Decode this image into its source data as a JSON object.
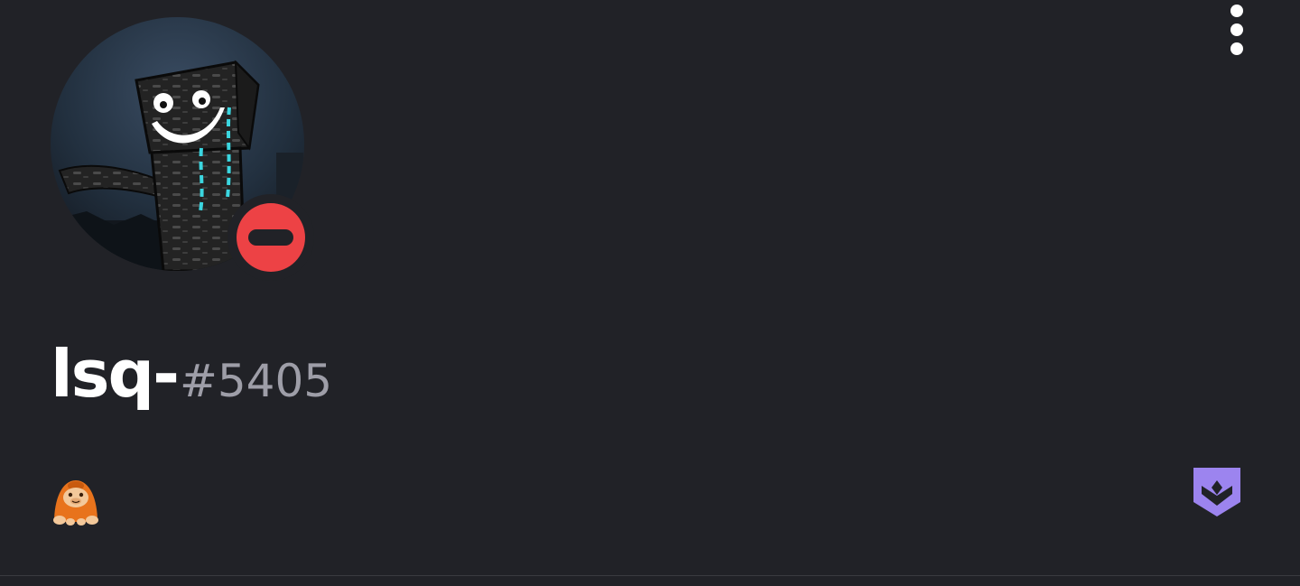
{
  "profile": {
    "username": "lsq-",
    "discriminator": "#5405",
    "status": "do-not-disturb",
    "status_color": "#ed4245",
    "background_color": "#212227"
  },
  "header": {
    "menu_icon": "more-vertical-icon"
  },
  "badges": [
    {
      "icon": "orangutan-badge-icon",
      "color": "#e8731c"
    },
    {
      "icon": "hypesquad-badge-icon",
      "color": "#9c84ef"
    }
  ]
}
